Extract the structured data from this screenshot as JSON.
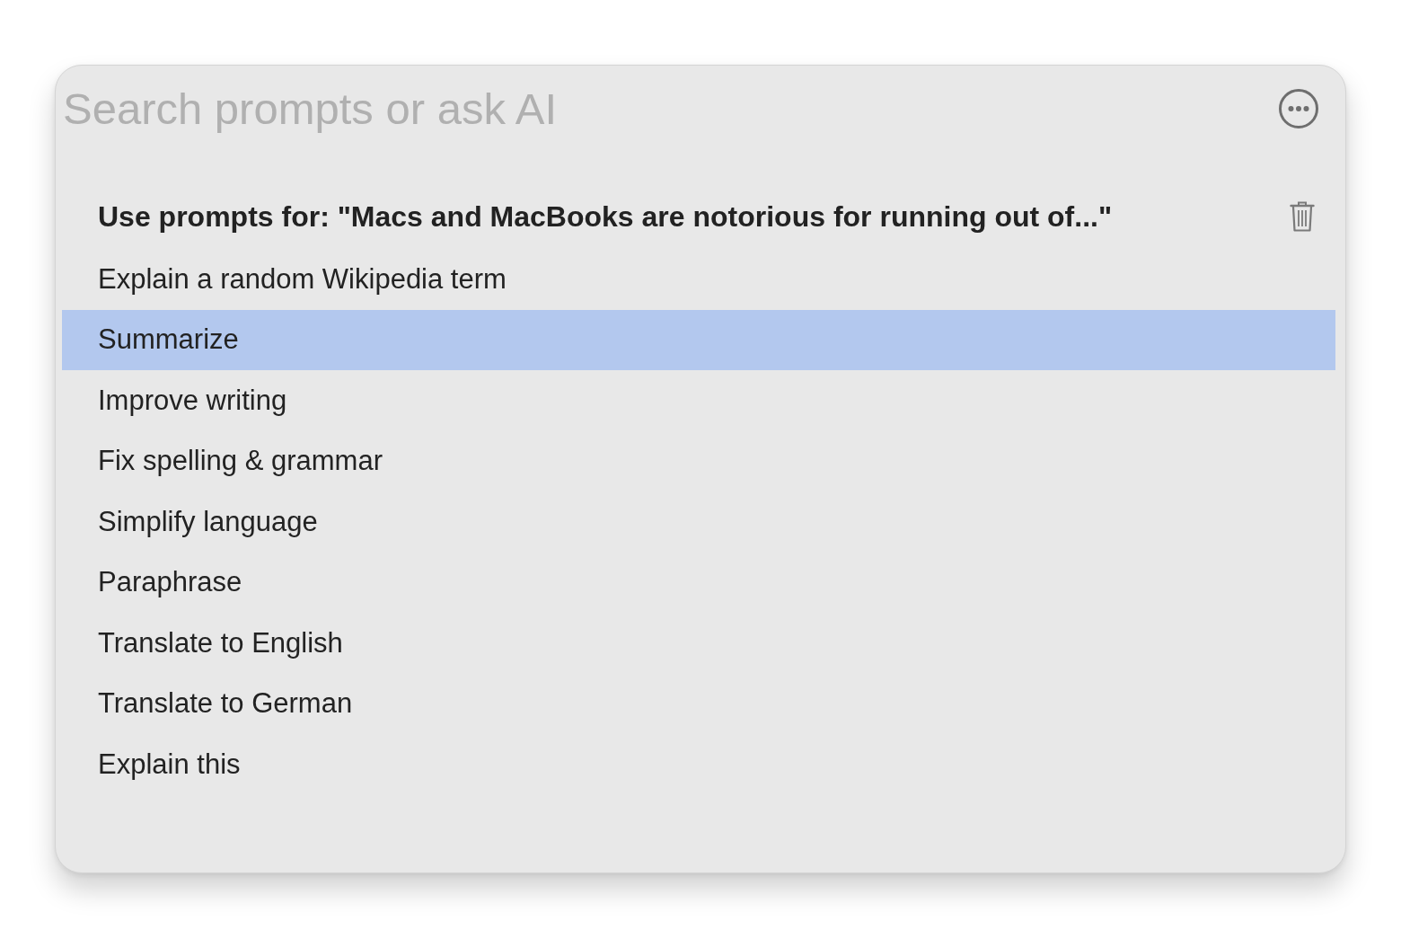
{
  "search": {
    "placeholder": "Search prompts or ask AI"
  },
  "context_header": {
    "text": "Use prompts for: \"Macs and MacBooks are notorious for running out of...\""
  },
  "prompts": [
    {
      "label": "Explain a random Wikipedia term",
      "selected": false
    },
    {
      "label": "Summarize",
      "selected": true
    },
    {
      "label": "Improve writing",
      "selected": false
    },
    {
      "label": "Fix spelling & grammar",
      "selected": false
    },
    {
      "label": "Simplify language",
      "selected": false
    },
    {
      "label": "Paraphrase",
      "selected": false
    },
    {
      "label": "Translate to English",
      "selected": false
    },
    {
      "label": "Translate to German",
      "selected": false
    },
    {
      "label": "Explain this",
      "selected": false
    }
  ]
}
